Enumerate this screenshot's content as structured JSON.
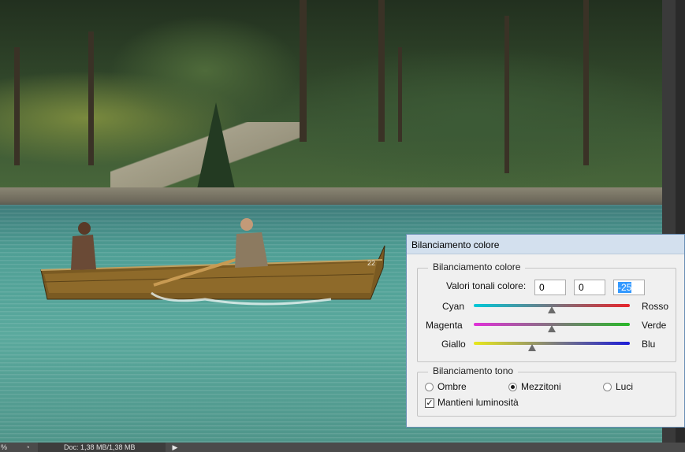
{
  "status_bar": {
    "zoom": "%",
    "doc_info": "Doc: 1,38 MB/1,38 MB",
    "icon": "info-icon"
  },
  "image": {
    "boat_number": "22"
  },
  "dialog": {
    "title": "Bilanciamento colore",
    "color_balance": {
      "group_label": "Bilanciamento colore",
      "tone_values_label": "Valori tonali colore:",
      "values": [
        "0",
        "0",
        "-25"
      ],
      "sliders": [
        {
          "left": "Cyan",
          "right": "Rosso",
          "value": 0,
          "colors": [
            "#00c8d8",
            "#e8242a"
          ]
        },
        {
          "left": "Magenta",
          "right": "Verde",
          "value": 0,
          "colors": [
            "#e030d8",
            "#28b828"
          ]
        },
        {
          "left": "Giallo",
          "right": "Blu",
          "value": -25,
          "colors": [
            "#e8e81c",
            "#1c1cd8"
          ]
        }
      ]
    },
    "tone_balance": {
      "group_label": "Bilanciamento tono",
      "options": [
        "Ombre",
        "Mezzitoni",
        "Luci"
      ],
      "selected": "Mezzitoni",
      "preserve_luminosity_label": "Mantieni luminosità",
      "preserve_luminosity": true
    }
  }
}
